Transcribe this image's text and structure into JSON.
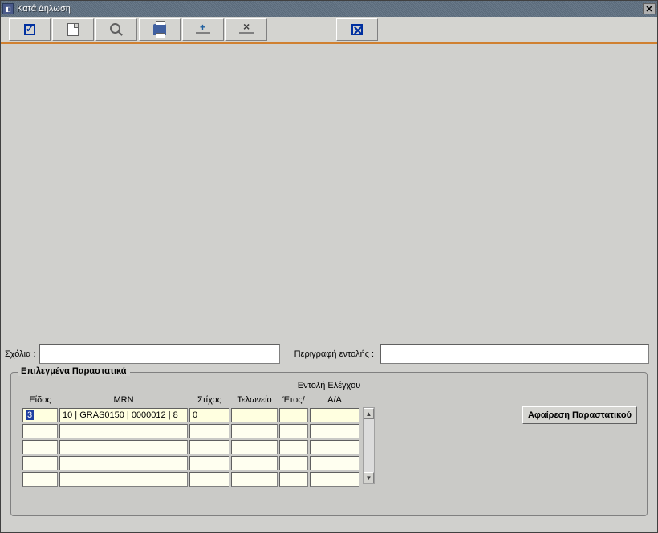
{
  "title": "Κατά Δήλωση",
  "toolbar": {
    "confirm": "confirm",
    "new": "new",
    "search": "search",
    "print": "print",
    "add_row": "add_row",
    "delete_row": "delete_row",
    "close": "close"
  },
  "form": {
    "comments_label": "Σχόλια :",
    "comments_value": "",
    "desc_label": "Περιγραφή εντολής :",
    "desc_value": ""
  },
  "group": {
    "title": "Επιλεγμένα Παραστατικά",
    "subtitle": "Εντολή Ελέγχου",
    "remove_button": "Αφαίρεση Παραστατικού",
    "columns": {
      "type": "Είδος",
      "mrn": "MRN",
      "line": "Στίχος",
      "office": "Τελωνείο",
      "year": "Έτος/",
      "aa": "Α/Α"
    },
    "rows": [
      {
        "type": "3",
        "mrn": "10 | GRAS0150 | 0000012 | 8",
        "line": "0",
        "office": "",
        "year": "",
        "aa": ""
      },
      {
        "type": "",
        "mrn": "",
        "line": "",
        "office": "",
        "year": "",
        "aa": ""
      },
      {
        "type": "",
        "mrn": "",
        "line": "",
        "office": "",
        "year": "",
        "aa": ""
      },
      {
        "type": "",
        "mrn": "",
        "line": "",
        "office": "",
        "year": "",
        "aa": ""
      },
      {
        "type": "",
        "mrn": "",
        "line": "",
        "office": "",
        "year": "",
        "aa": ""
      }
    ]
  }
}
